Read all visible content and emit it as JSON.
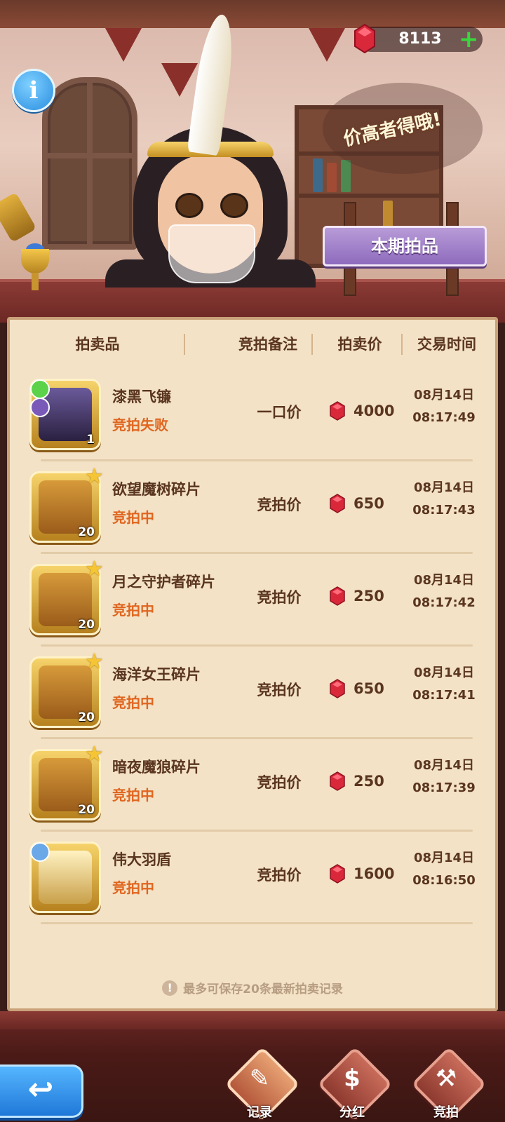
{
  "header": {
    "currency_amount": "8113",
    "plus_symbol": "+",
    "info_symbol": "i",
    "speech_text": "价高者得哦!",
    "sign_text": "本期拍品"
  },
  "table": {
    "columns": [
      "拍卖品",
      "竞拍备注",
      "拍卖价",
      "交易时间"
    ],
    "rows": [
      {
        "name": "漆黑飞镰",
        "status": "竞拍失败",
        "note": "一口价",
        "price": "4000",
        "date": "08月14日",
        "time": "08:17:49",
        "count": "1",
        "kind": "equip-dark"
      },
      {
        "name": "欲望魔树碎片",
        "status": "竞拍中",
        "note": "竞拍价",
        "price": "650",
        "date": "08月14日",
        "time": "08:17:43",
        "count": "20",
        "kind": "fragment"
      },
      {
        "name": "月之守护者碎片",
        "status": "竞拍中",
        "note": "竞拍价",
        "price": "250",
        "date": "08月14日",
        "time": "08:17:42",
        "count": "20",
        "kind": "fragment"
      },
      {
        "name": "海洋女王碎片",
        "status": "竞拍中",
        "note": "竞拍价",
        "price": "650",
        "date": "08月14日",
        "time": "08:17:41",
        "count": "20",
        "kind": "fragment"
      },
      {
        "name": "暗夜魔狼碎片",
        "status": "竞拍中",
        "note": "竞拍价",
        "price": "250",
        "date": "08月14日",
        "time": "08:17:39",
        "count": "20",
        "kind": "fragment"
      },
      {
        "name": "伟大羽盾",
        "status": "竞拍中",
        "note": "竞拍价",
        "price": "1600",
        "date": "08月14日",
        "time": "08:16:50",
        "count": "",
        "kind": "equip-gold"
      }
    ],
    "footer_note": "最多可保存20条最新拍卖记录",
    "footer_icon": "!"
  },
  "bottom": {
    "back_symbol": "↩",
    "tabs": [
      {
        "label": "记录",
        "glyph": "✎"
      },
      {
        "label": "分红",
        "glyph": "$"
      },
      {
        "label": "竞拍",
        "glyph": "⚒"
      }
    ]
  },
  "colors": {
    "gem": "#d8283a",
    "status_orange": "#e0651f",
    "text_brown": "#5a3520",
    "plus_green": "#39d63c"
  }
}
